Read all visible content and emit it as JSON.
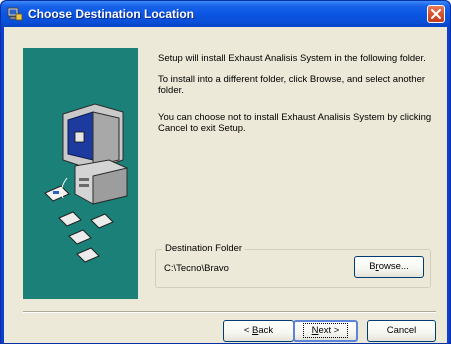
{
  "window": {
    "title": "Choose Destination Location",
    "titlebar_color": "#0a55e3",
    "client_bg": "#ece9d8",
    "side_panel_color": "#1b8078"
  },
  "messages": {
    "line1": "Setup will install Exhaust Analisis System in the following folder.",
    "line2": "To install into a different folder, click Browse, and select another folder.",
    "line3": "You can choose not to install Exhaust Analisis System by clicking Cancel to exit Setup."
  },
  "destination": {
    "legend": "Destination Folder",
    "path": "C:\\Tecno\\Bravo"
  },
  "buttons": {
    "browse_pre": "B",
    "browse_underline": "r",
    "browse_post": "owse...",
    "back_pre": "< ",
    "back_underline": "B",
    "back_post": "ack",
    "next_underline": "N",
    "next_post": "ext >",
    "cancel": "Cancel"
  },
  "icons": {
    "title": "setup-icon",
    "close": "close-icon",
    "illustration": "computer-install-illustration"
  }
}
